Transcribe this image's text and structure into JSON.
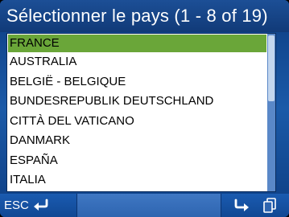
{
  "header": {
    "title": "Sélectionner le pays (1 - 8 of 19)"
  },
  "country_list": {
    "selected_index": 0,
    "items": [
      "FRANCE",
      "AUSTRALIA",
      "BELGIË - BELGIQUE",
      "BUNDESREPUBLIK DEUTSCHLAND",
      "CITTÀ DEL VATICANO",
      "DANMARK",
      "ESPAÑA",
      "ITALIA"
    ]
  },
  "footer": {
    "esc_label": "ESC",
    "esc_icon": "return-arrow-icon",
    "enter_icon": "enter-arrow-icon",
    "pages_icon": "pages-icon"
  },
  "colors": {
    "title_bar": "#113a78",
    "selection": "#6aa639",
    "list_background": "#ffffff",
    "footer": "#1a5bb0"
  }
}
